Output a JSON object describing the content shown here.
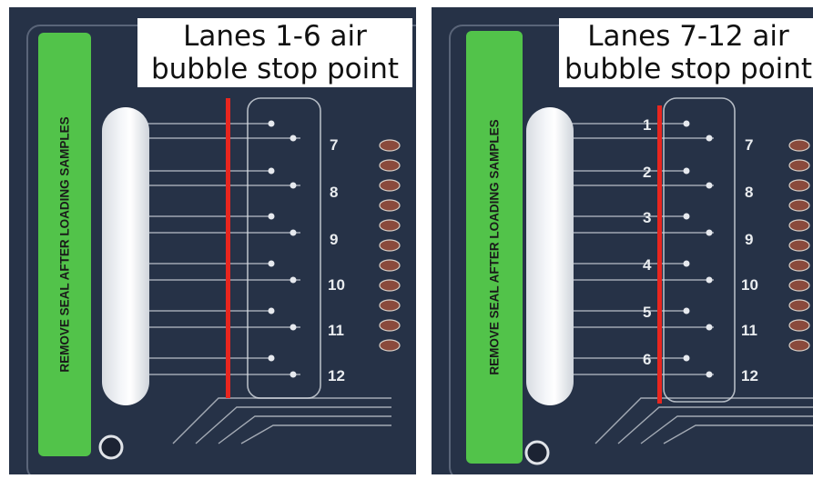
{
  "panels": [
    {
      "caption_line1": "Lanes 1-6 air",
      "caption_line2": "bubble stop point",
      "seal_text": "REMOVE SEAL AFTER LOADING SAMPLES",
      "outlet_labels": [
        "7",
        "8",
        "9",
        "10",
        "11",
        "12"
      ]
    },
    {
      "caption_line1": "Lanes 7-12 air",
      "caption_line2": "bubble stop point",
      "seal_text": "REMOVE SEAL AFTER LOADING SAMPLES",
      "inlet_labels": [
        "1",
        "2",
        "3",
        "4",
        "5",
        "6"
      ],
      "outlet_labels": [
        "7",
        "8",
        "9",
        "10",
        "11",
        "12"
      ]
    }
  ],
  "colors": {
    "board": "#263247",
    "seal": "#52c34a",
    "stop_line": "#e8261f",
    "channel": "#c9cfd8"
  }
}
